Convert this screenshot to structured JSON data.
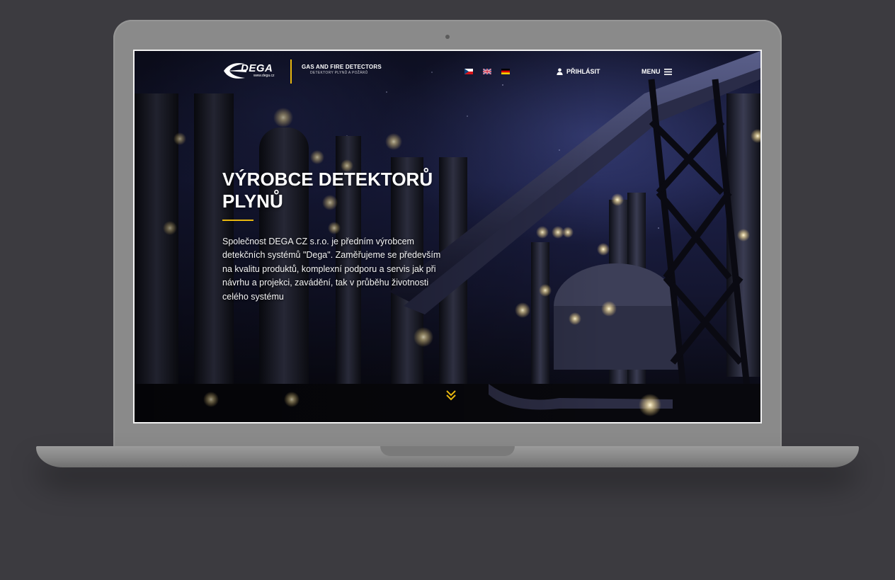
{
  "header": {
    "logo_text": "DEGA",
    "logo_url": "www.dega.cz",
    "tagline_main": "GAS AND FIRE DETECTORS",
    "tagline_sub": "DETEKTORY PLYNŮ A POŽÁRŮ",
    "languages": [
      {
        "code": "cz",
        "icon": "czech-flag-icon"
      },
      {
        "code": "en",
        "icon": "uk-flag-icon"
      },
      {
        "code": "de",
        "icon": "german-flag-icon"
      }
    ],
    "login_label": "PŘIHLÁSIT",
    "menu_label": "MENU"
  },
  "hero": {
    "title": "VÝROBCE DETEKTORŮ PLYNŮ",
    "text": "Společnost DEGA CZ s.r.o. je předním výrobcem detekčních systémů \"Dega\". Zaměřujeme se především na kvalitu produktů, komplexní podporu a servis jak při návrhu a projekci, zavádění, tak v průběhu životnosti celého systému"
  },
  "colors": {
    "accent": "#e8b70f",
    "laptop": "#8a8a8a",
    "background": "#3c3b40"
  }
}
